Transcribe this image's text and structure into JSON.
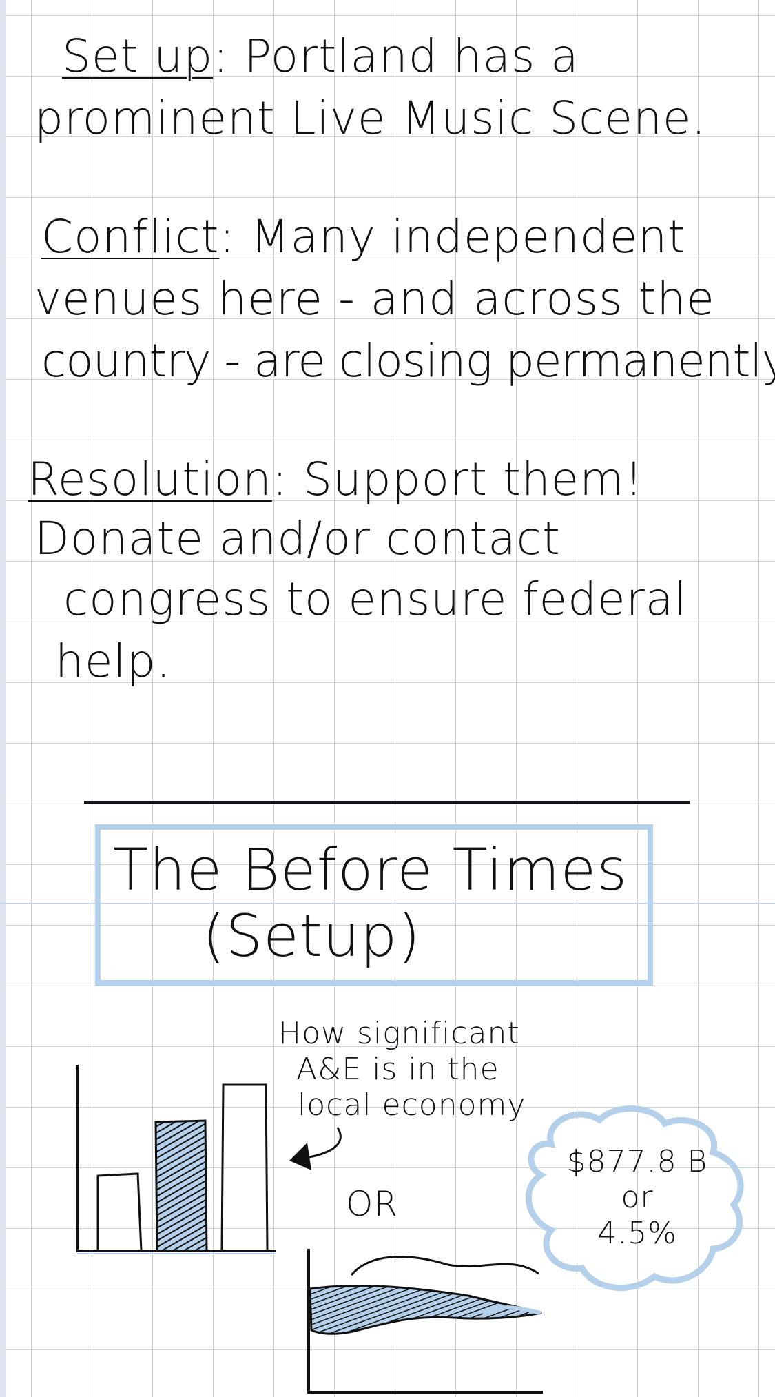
{
  "notes": {
    "setup": {
      "label": "Set up",
      "text": ": Portland has a",
      "text2": "prominent Live Music Scene."
    },
    "conflict": {
      "label": "Conflict",
      "text": ": Many independent",
      "text2": "venues here - and across the",
      "text3": "country - are closing permanently"
    },
    "resolution": {
      "label": "Resolution",
      "text": ": Support them!",
      "text2": "Donate and/or contact",
      "text3": "congress to ensure federal",
      "text4": "help."
    }
  },
  "section": {
    "title_line1": "The Before Times",
    "title_line2": "(Setup)"
  },
  "sketch": {
    "annotation_line1": "How significant",
    "annotation_line2": "A&E is in the",
    "annotation_line3": "local economy",
    "or_label": "OR",
    "cloud_line1": "$877.8 B",
    "cloud_line2": "or",
    "cloud_line3": "4.5%"
  },
  "colors": {
    "ink": "#111111",
    "grid": "#c9d3e6",
    "highlight_blue": "#b4d0ea"
  },
  "icons": {
    "arrow": "hand-drawn-arrow-icon",
    "cloud": "thought-cloud-icon"
  }
}
